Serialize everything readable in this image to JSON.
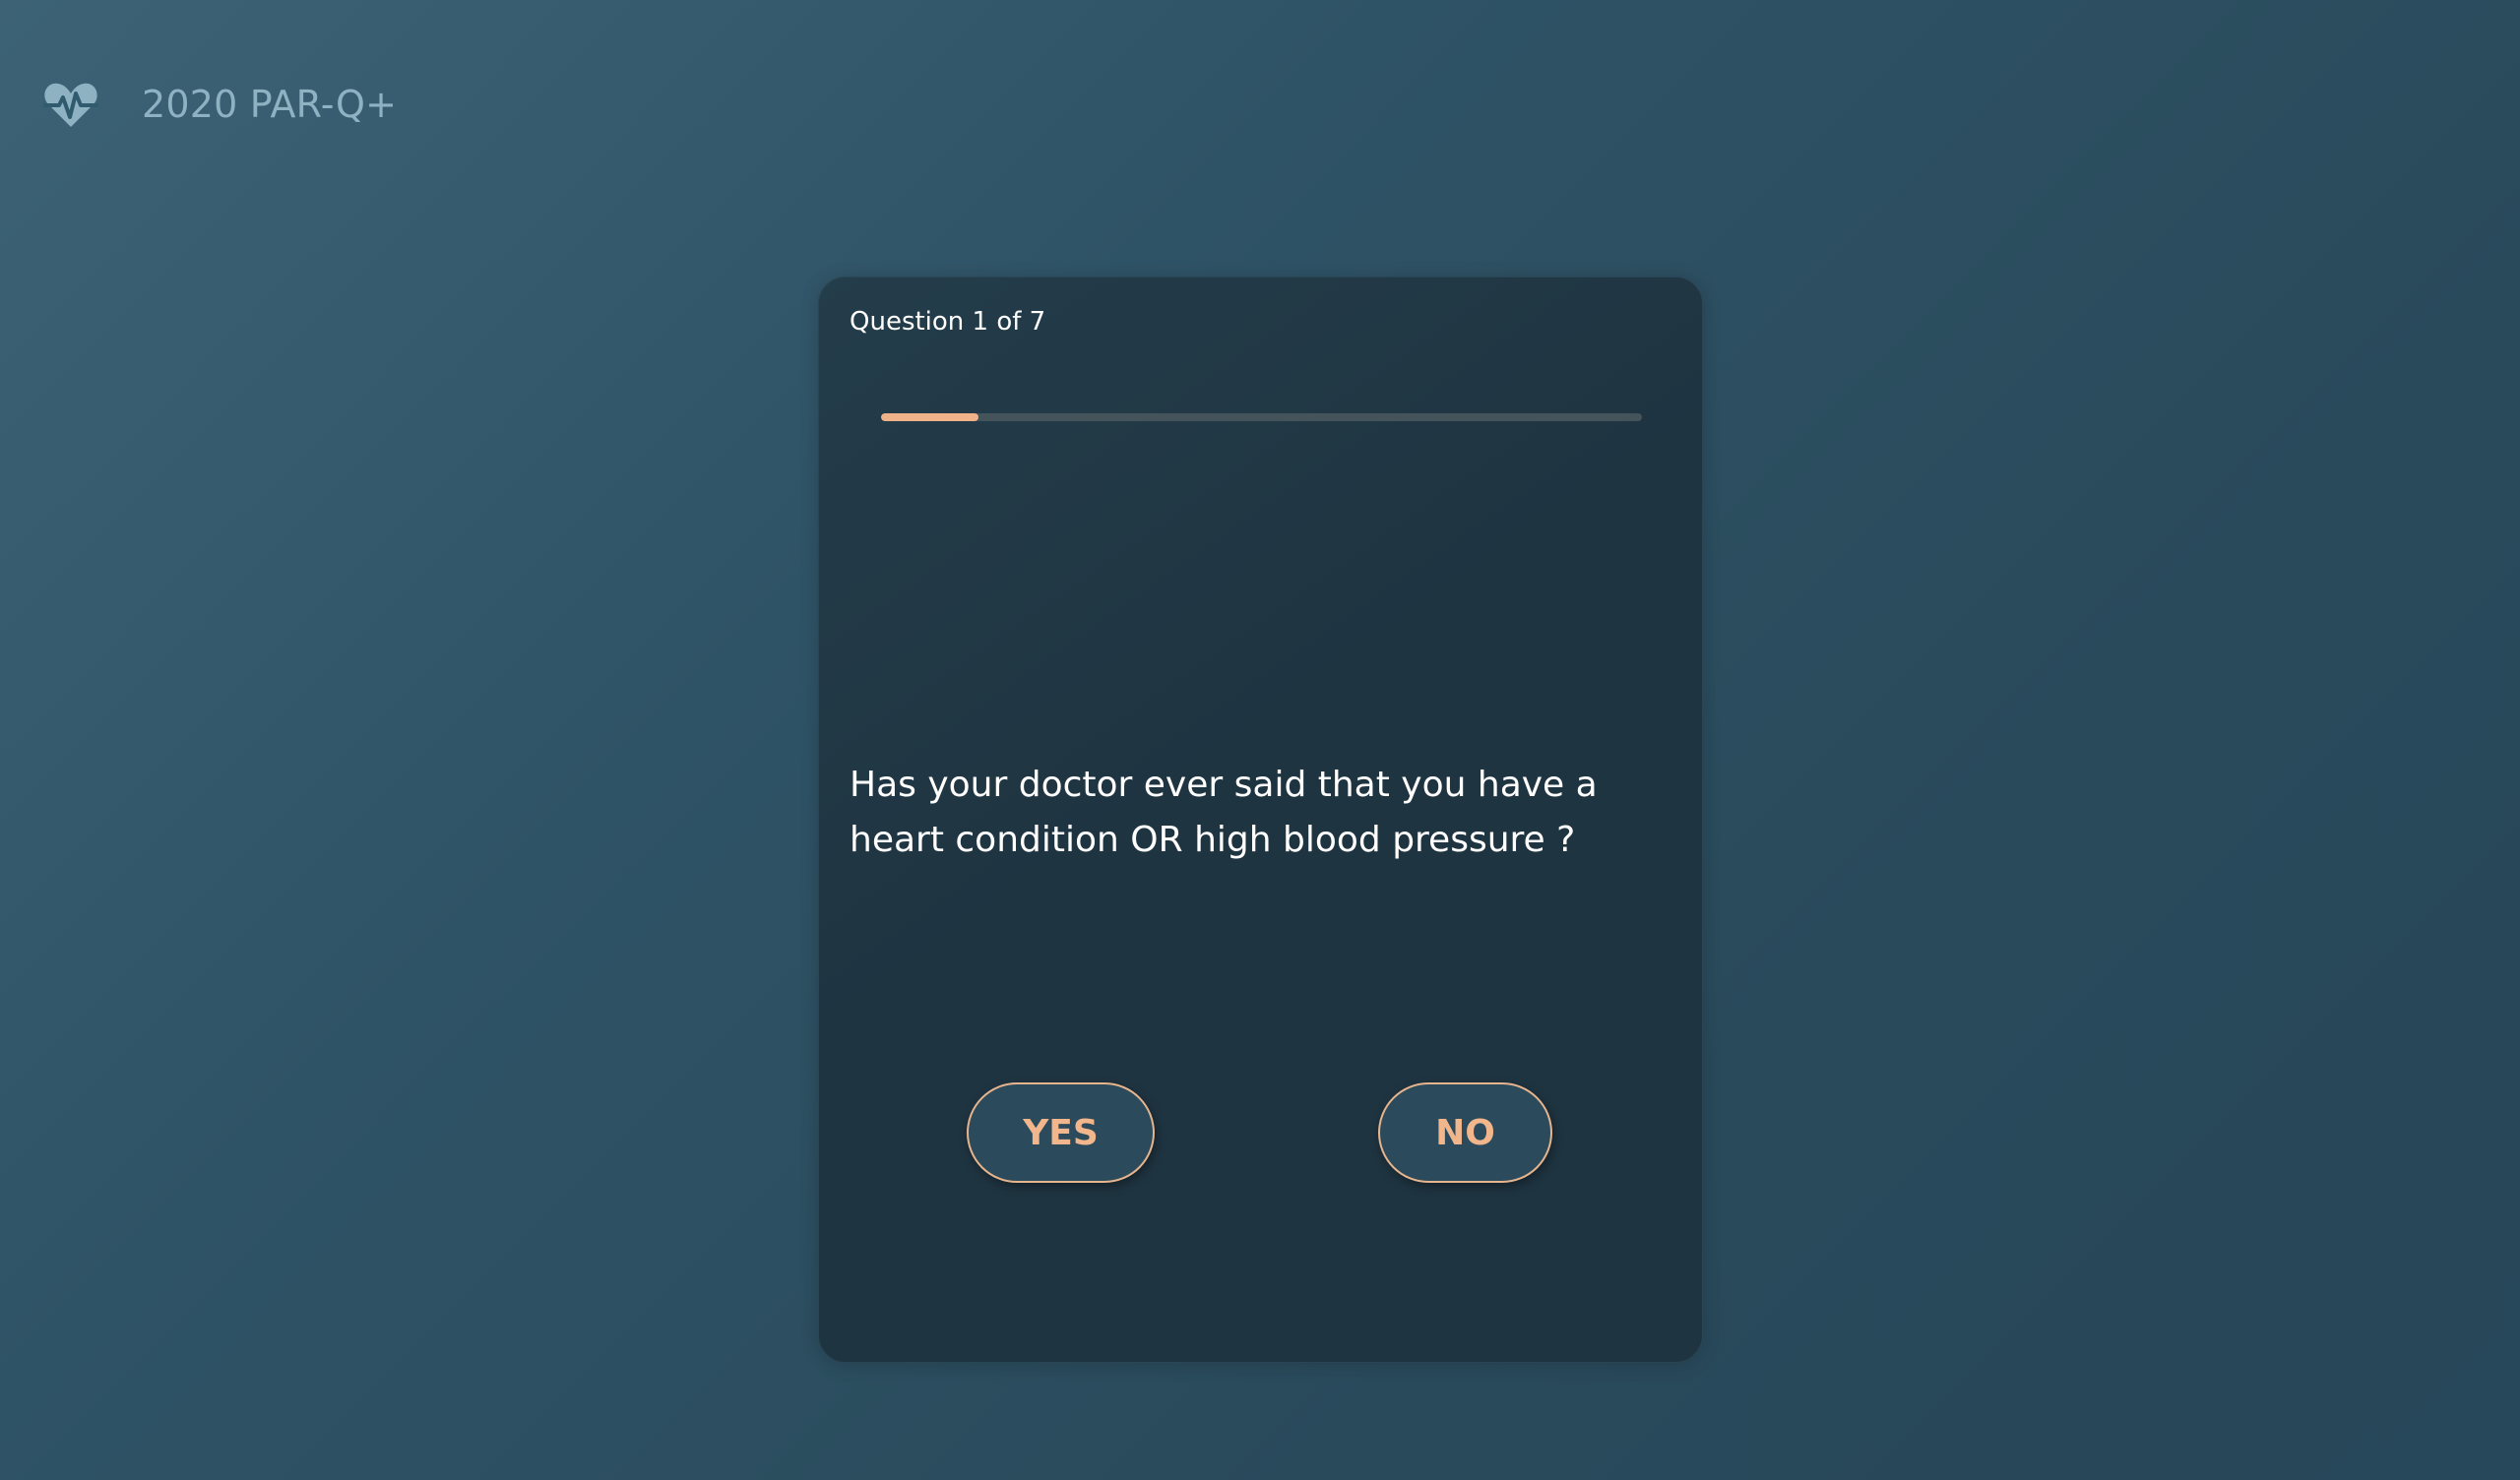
{
  "header": {
    "logo_icon": "heart-pulse-icon",
    "title": "2020 PAR-Q+"
  },
  "quiz": {
    "counter": "Question 1 of 7",
    "progress": {
      "current": 1,
      "total": 7,
      "fraction": 0.1286
    },
    "question": "Has your doctor ever said that you have a heart condition OR high blood pressure ?",
    "answers": {
      "yes_label": "YES",
      "no_label": "NO"
    }
  },
  "colors": {
    "accent": "#f0b288",
    "icon": "#8fb2c3",
    "card": "#1f3441",
    "button_bg": "#2b4a5b"
  }
}
